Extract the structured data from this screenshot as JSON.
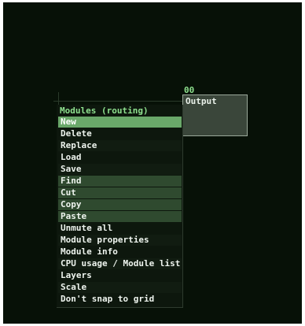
{
  "module": {
    "id": "00",
    "label": "Output"
  },
  "menu": {
    "title": "Modules (routing)",
    "items": [
      {
        "label": "New"
      },
      {
        "label": "Delete"
      },
      {
        "label": "Replace"
      },
      {
        "label": "Load"
      },
      {
        "label": "Save"
      },
      {
        "label": "Find"
      },
      {
        "label": "Cut"
      },
      {
        "label": "Copy"
      },
      {
        "label": "Paste"
      },
      {
        "label": "Unmute all"
      },
      {
        "label": "Module properties"
      },
      {
        "label": "Module info"
      },
      {
        "label": "CPU usage / Module list"
      },
      {
        "label": "Layers"
      },
      {
        "label": "Scale"
      },
      {
        "label": "Don't snap to grid"
      }
    ]
  },
  "colors": {
    "background": "#071107",
    "accent": "#8ee08e",
    "selected": "#6aa86a"
  }
}
